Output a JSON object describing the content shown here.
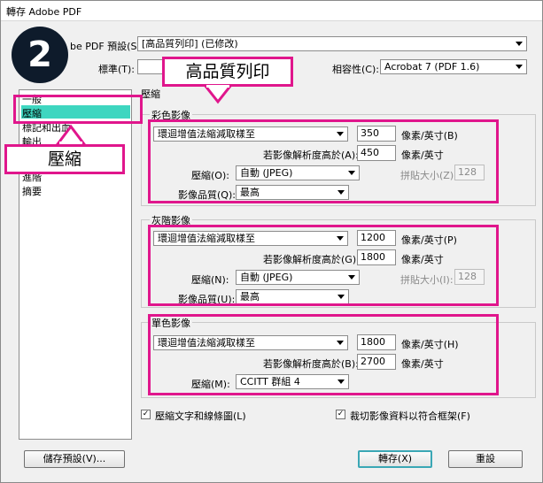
{
  "window": {
    "title": "轉存 Adobe PDF"
  },
  "step_badge": "2",
  "callouts": {
    "top": "高品質列印",
    "left": "壓縮"
  },
  "header": {
    "preset_label": "be PDF 預設(S):",
    "preset_value": "[高品質列印] (已修改)",
    "standard_label": "標準(T):",
    "compat_label": "相容性(C):",
    "compat_value": "Acrobat 7 (PDF 1.6)"
  },
  "sidebar": {
    "items": [
      "一般",
      "壓縮",
      "標記和出血",
      "輸出",
      "進階",
      "摘要"
    ]
  },
  "section_title": "壓縮",
  "color": {
    "title": "彩色影像",
    "downsample": "環迴增值法縮減取樣至",
    "ppi1": "350",
    "unit1": "像素/英寸(B)",
    "above_label": "若影像解析度高於(A):",
    "ppi2": "450",
    "unit2": "像素/英寸",
    "compress_label": "壓縮(O):",
    "compress_value": "自動 (JPEG)",
    "tile_label": "拼貼大小(Z):",
    "tile_value": "128",
    "quality_label": "影像品質(Q):",
    "quality_value": "最高"
  },
  "gray": {
    "title": "灰階影像",
    "downsample": "環迴增值法縮減取樣至",
    "ppi1": "1200",
    "unit1": "像素/英寸(P)",
    "above_label": "若影像解析度高於(G):",
    "ppi2": "1800",
    "unit2": "像素/英寸",
    "compress_label": "壓縮(N):",
    "compress_value": "自動 (JPEG)",
    "tile_label": "拼貼大小(I):",
    "tile_value": "128",
    "quality_label": "影像品質(U):",
    "quality_value": "最高"
  },
  "mono": {
    "title": "單色影像",
    "downsample": "環迴增值法縮減取樣至",
    "ppi1": "1800",
    "unit1": "像素/英寸(H)",
    "above_label": "若影像解析度高於(B):",
    "ppi2": "2700",
    "unit2": "像素/英寸",
    "compress_label": "壓縮(M):",
    "compress_value": "CCITT 群組 4"
  },
  "checks": {
    "compress_text": "壓縮文字和線條圖(L)",
    "crop_images": "裁切影像資料以符合框架(F)"
  },
  "buttons": {
    "save_preset": "儲存預設(V)...",
    "export": "轉存(X)",
    "reset": "重設"
  }
}
